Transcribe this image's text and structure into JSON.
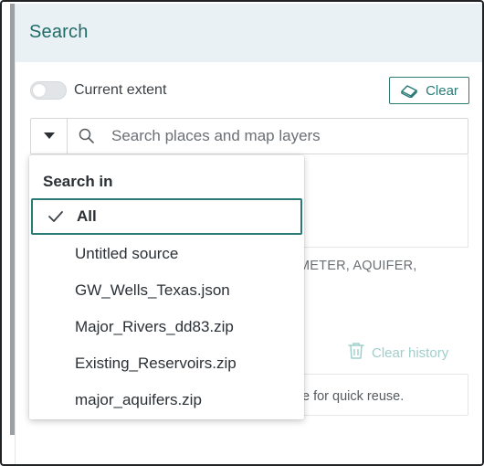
{
  "panel": {
    "title": "Search"
  },
  "toggle": {
    "label": "Current extent",
    "on": false
  },
  "clear_button": {
    "label": "Clear",
    "icon": "eraser-icon"
  },
  "search": {
    "placeholder": "Search places and map layers",
    "value": ""
  },
  "hint_partial": "METER, AQUIFER,",
  "history": {
    "clear_label": "Clear history",
    "empty_partial": "e for quick reuse."
  },
  "dropdown": {
    "heading": "Search in",
    "items": [
      {
        "label": "All",
        "selected": true
      },
      {
        "label": "Untitled source",
        "selected": false
      },
      {
        "label": "GW_Wells_Texas.json",
        "selected": false
      },
      {
        "label": "Major_Rivers_dd83.zip",
        "selected": false
      },
      {
        "label": "Existing_Reservoirs.zip",
        "selected": false
      },
      {
        "label": "major_aquifers.zip",
        "selected": false
      }
    ]
  },
  "colors": {
    "accent": "#2a7a76",
    "header_bg": "#eaf1f5",
    "muted_accent": "#9fcfcb"
  }
}
